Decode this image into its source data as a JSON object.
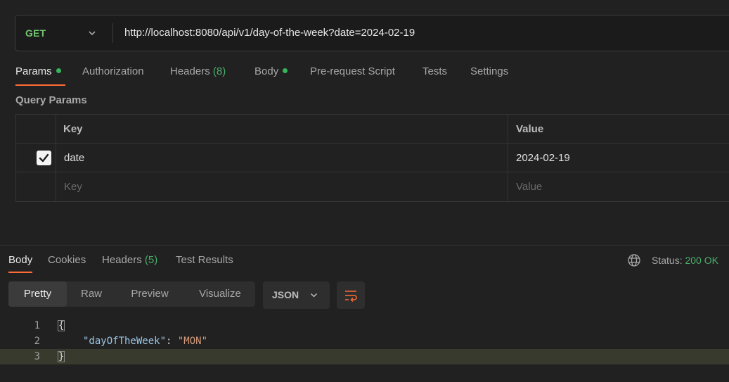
{
  "request": {
    "method": "GET",
    "url": "http://localhost:8080/api/v1/day-of-the-week?date=2024-02-19"
  },
  "request_tabs": [
    {
      "label": "Params",
      "dot": true
    },
    {
      "label": "Authorization"
    },
    {
      "label": "Headers",
      "count": "(8)"
    },
    {
      "label": "Body",
      "dot": true
    },
    {
      "label": "Pre-request Script"
    },
    {
      "label": "Tests"
    },
    {
      "label": "Settings"
    }
  ],
  "query_params": {
    "title": "Query Params",
    "headers": {
      "key": "Key",
      "value": "Value"
    },
    "rows": [
      {
        "checked": true,
        "key": "date",
        "value": "2024-02-19"
      }
    ],
    "placeholder": {
      "key": "Key",
      "value": "Value"
    }
  },
  "response_tabs": [
    {
      "label": "Body"
    },
    {
      "label": "Cookies"
    },
    {
      "label": "Headers",
      "count": "(5)"
    },
    {
      "label": "Test Results"
    }
  ],
  "status": {
    "label": "Status:",
    "value": "200 OK"
  },
  "view_modes": [
    "Pretty",
    "Raw",
    "Preview",
    "Visualize"
  ],
  "format": "JSON",
  "code": {
    "line_numbers": [
      "1",
      "2",
      "3"
    ],
    "open_brace": "{",
    "key": "\"dayOfTheWeek\"",
    "colon": ": ",
    "value": "\"MON\"",
    "close_brace": "}"
  },
  "colors": {
    "accent": "#ff6c37",
    "method": "#73c46f",
    "success": "#4ab06a"
  },
  "icons": [
    "chevron-down-icon",
    "checkmark-icon",
    "globe-icon",
    "wrap-lines-icon"
  ]
}
